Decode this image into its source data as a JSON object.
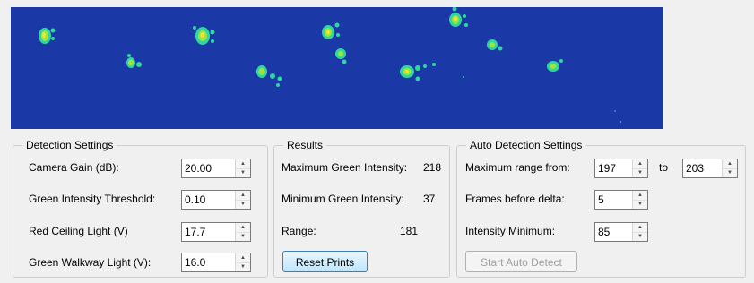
{
  "detection": {
    "title": "Detection Settings",
    "camera_gain_label": "Camera Gain (dB):",
    "camera_gain_value": "20.00",
    "green_threshold_label": "Green Intensity Threshold:",
    "green_threshold_value": "0.10",
    "red_ceiling_label": "Red Ceiling Light (V)",
    "red_ceiling_value": "17.7",
    "green_walkway_label": "Green Walkway Light (V):",
    "green_walkway_value": "16.0"
  },
  "results": {
    "title": "Results",
    "max_green_label": "Maximum Green Intensity:",
    "max_green_value": "218",
    "min_green_label": "Minimum Green Intensity:",
    "min_green_value": "37",
    "range_label": "Range:",
    "range_value": "181",
    "reset_button": "Reset Prints"
  },
  "auto": {
    "title": "Auto Detection Settings",
    "max_range_label": "Maximum range from:",
    "range_from_value": "197",
    "to_label": "to",
    "range_to_value": "203",
    "frames_label": "Frames before delta:",
    "frames_value": "5",
    "intensity_label": "Intensity Minimum:",
    "intensity_value": "85",
    "start_button": "Start Auto Detect"
  },
  "colors": {
    "camera_background": "#1a38a6",
    "print_outer": "#2fd6a0",
    "print_mid": "#9be63a",
    "print_core": "#f2e23a"
  }
}
